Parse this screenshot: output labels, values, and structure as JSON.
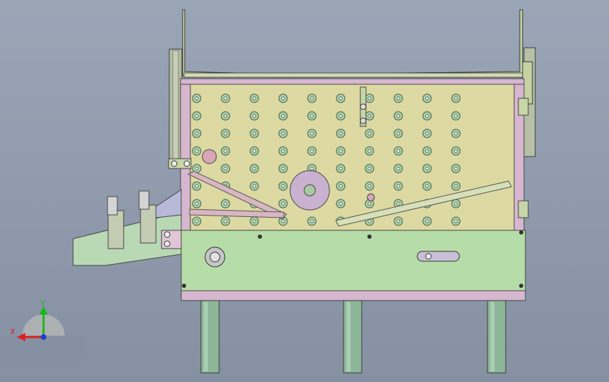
{
  "viewport": {
    "background_top": "#9aa6b6",
    "background_bottom": "#8591a3"
  },
  "model": {
    "plate_color": "#dcd9a2",
    "frame_color": "#d7b7cf",
    "base_color": "#b6dca8",
    "chute_color": "#b9d8b4",
    "leg_color": "#8db597",
    "hole_color": "#a7d3a8",
    "link_color": "#d8b7c2",
    "grid": {
      "rows": 8,
      "cols": 10
    }
  },
  "triad": {
    "x_label": "X",
    "y_label": "Y",
    "x_color": "#e02020",
    "y_color": "#18b818",
    "z_color": "#1f3fd0"
  }
}
